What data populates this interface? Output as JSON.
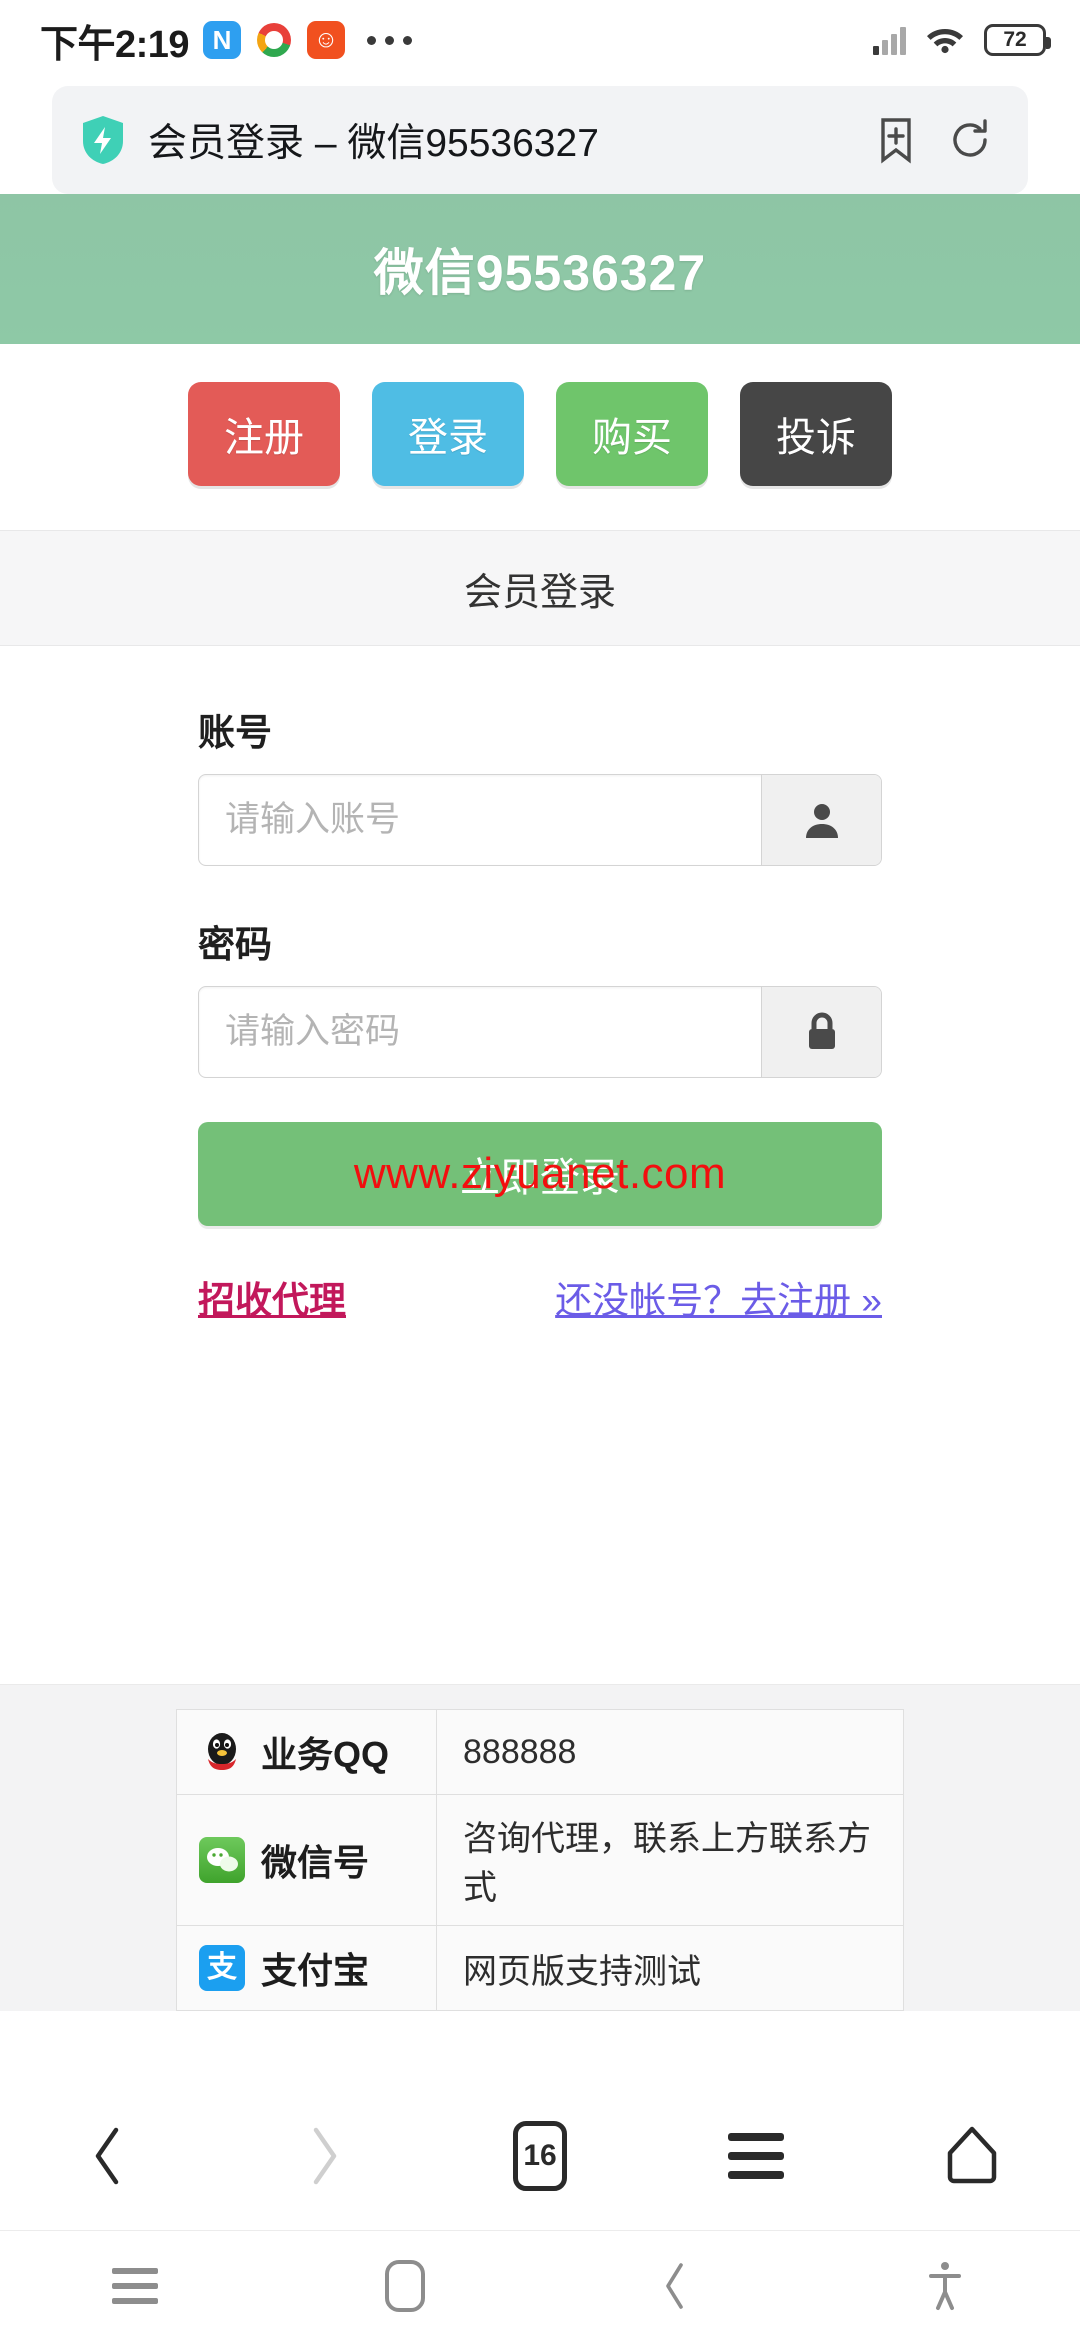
{
  "statusbar": {
    "time": "下午2:19",
    "notification_icons": [
      "note-app-icon",
      "browser-app-icon",
      "game-app-icon"
    ],
    "overflow": "more-notifications-icon",
    "battery_percent": "72",
    "signal": "cellular-signal-icon",
    "wifi": "wifi-icon"
  },
  "browser": {
    "addressbar": {
      "security_icon": "shield-lightning-icon",
      "title": "会员登录 – 微信95536327",
      "bookmark_icon": "bookmark-add-icon",
      "refresh_icon": "refresh-icon"
    },
    "toolbar": {
      "back": "back-chevron-icon",
      "forward": "forward-chevron-icon",
      "tab_count": "16",
      "menu": "menu-icon",
      "home": "home-icon"
    }
  },
  "page": {
    "header_title": "微信95536327",
    "header_color": "#8ec5a5",
    "nav_buttons": [
      {
        "label": "注册",
        "color": "#e35b57"
      },
      {
        "label": "登录",
        "color": "#4fbde4"
      },
      {
        "label": "购买",
        "color": "#6fc56b"
      },
      {
        "label": "投诉",
        "color": "#464646"
      }
    ],
    "panel_title": "会员登录",
    "form": {
      "account": {
        "label": "账号",
        "value": "",
        "placeholder": "请输入账号",
        "addon_icon": "user-icon"
      },
      "password": {
        "label": "密码",
        "value": "",
        "placeholder": "请输入密码",
        "addon_icon": "lock-icon"
      },
      "submit_label": "立即登录",
      "submit_color": "#74c078"
    },
    "watermark": {
      "text": "www.ziyuanet.com",
      "color": "#f20f0f"
    },
    "links": {
      "agent": {
        "label": "招收代理",
        "color": "#c2185b"
      },
      "register": {
        "label": "还没帐号？去注册 »",
        "color": "#6b5ce7"
      }
    },
    "contact_table": [
      {
        "icon": "qq-penguin-icon",
        "key": "业务QQ",
        "value": "888888"
      },
      {
        "icon": "wechat-icon",
        "key": "微信号",
        "value": "咨询代理，联系上方联系方式"
      },
      {
        "icon": "alipay-icon",
        "key": "支付宝",
        "value": "网页版支持测试"
      }
    ]
  },
  "sysnav": {
    "recents": "recents-icon",
    "home": "home-square-icon",
    "back": "back-icon",
    "accessibility": "accessibility-icon"
  }
}
